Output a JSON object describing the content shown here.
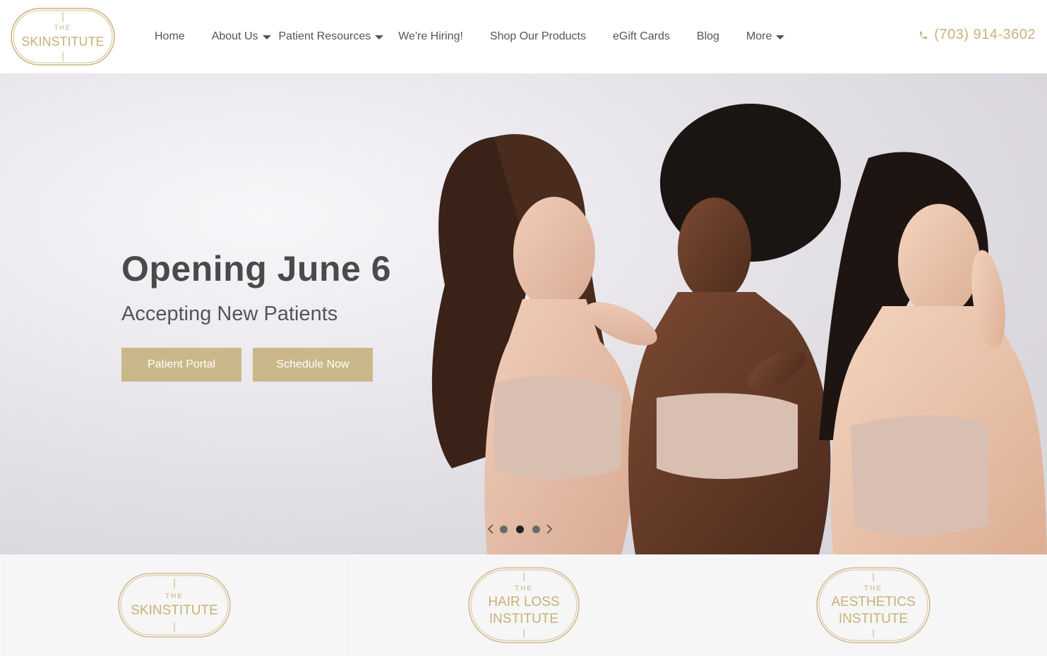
{
  "header": {
    "logo": {
      "top": "THE",
      "main": "SKINSTITUTE"
    },
    "nav": [
      {
        "label": "Home",
        "dropdown": false
      },
      {
        "label": "About Us",
        "dropdown": true
      },
      {
        "label": "Patient Resources",
        "dropdown": true
      },
      {
        "label": "We're Hiring!",
        "dropdown": false
      },
      {
        "label": "Shop Our Products",
        "dropdown": false
      },
      {
        "label": "eGift Cards",
        "dropdown": false
      },
      {
        "label": "Blog",
        "dropdown": false
      },
      {
        "label": "More",
        "dropdown": true
      }
    ],
    "phone": "(703) 914-3602",
    "phone_icon": "phone-icon"
  },
  "hero": {
    "title": "Opening June 6",
    "subtitle": "Accepting New Patients",
    "buttons": {
      "portal": "Patient Portal",
      "schedule": "Schedule Now"
    },
    "slider": {
      "slides": 3,
      "active_index": 1
    }
  },
  "institutes": [
    {
      "top": "THE",
      "line1": "SKINSTITUTE",
      "line2": ""
    },
    {
      "top": "THE",
      "line1": "HAIR LOSS",
      "line2": "INSTITUTE"
    },
    {
      "top": "THE",
      "line1": "AESTHETICS",
      "line2": "INSTITUTE"
    }
  ],
  "colors": {
    "gold": "#c9b07a",
    "button": "#cbb88a",
    "text": "#4a4a4a"
  }
}
